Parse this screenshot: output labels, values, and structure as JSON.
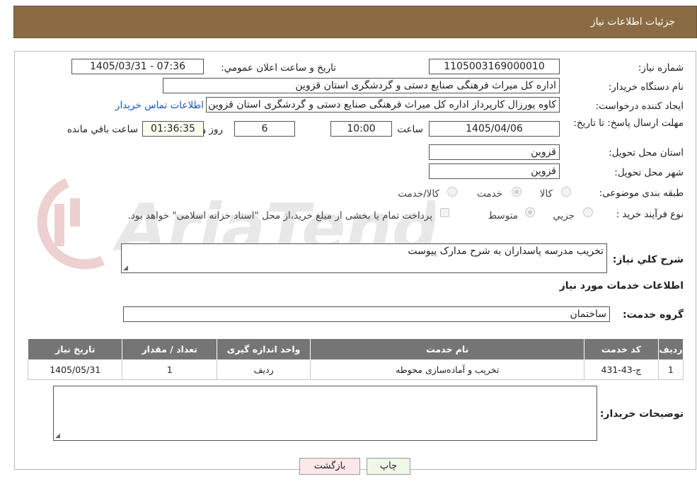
{
  "header": {
    "title": "جزئیات اطلاعات نیاز"
  },
  "form": {
    "need_number_label": "شماره نیاز:",
    "need_number": "1105003169000010",
    "announce_label": "تاریخ و ساعت اعلان عمومي:",
    "announce_value": "1405/03/31 - 07:36",
    "buyer_org_label": "نام دستگاه خريدار:",
    "buyer_org": "اداره کل میراث فرهنگی  صنایع دستی و گردشگری استان قزوین",
    "creator_label": "ايجاد کننده درخواست:",
    "creator": "کاوه پورزال کارپرداز اداره کل میراث فرهنگی  صنایع دستی و گردشگری استان قزوین",
    "contact_link": "اطلاعات تماس خريدار",
    "deadline_label": "مهلت ارسال پاسخ: تا تاريخ:",
    "deadline_date": "1405/04/06",
    "time_label": "ساعت",
    "deadline_time": "10:00",
    "days_value": "6",
    "days_label": "روز و",
    "remaining_time": "01:36:35",
    "remaining_label": "ساعت باقي مانده",
    "province_label": "استان محل تحويل:",
    "province": "قزوین",
    "city_label": "شهر محل تحويل:",
    "city": "قزوین",
    "category_label": "طبقه بندی موضوعی:",
    "category_options": [
      "کالا",
      "خدمت",
      "کالا/خدمت"
    ],
    "process_label": "نوع فرآيند خريد :",
    "process_options": [
      "جزيي",
      "متوسط"
    ],
    "payment_note": "پرداخت تمام یا بخشی از مبلغ خرید،از محل \"اسناد خزانه اسلامی\" خواهد بود.",
    "summary_label": "شرح کلي نياز:",
    "summary": "تخریب مدرسه پاسداران به شرح مدارک پیوست",
    "services_title": "اطلاعات خدمات مورد نياز",
    "service_group_label": "گروه خدمت:",
    "service_group": "ساختمان",
    "buyer_notes_label": "توضيحات خريدار:",
    "buyer_notes": ""
  },
  "table": {
    "headers": [
      "رديف",
      "کد خدمت",
      "نام خدمت",
      "واحد اندازه گيری",
      "تعداد / مقدار",
      "تاريخ نياز"
    ],
    "rows": [
      [
        "1",
        "ج-43-431",
        "تخریب و آماده‌سازی محوطه",
        "ردیف",
        "1",
        "1405/05/31"
      ]
    ]
  },
  "buttons": {
    "print": "چاپ",
    "back": "بازگشت"
  },
  "watermark": "AriaTender.neT",
  "colors": {
    "header": "#8b6b43",
    "table_header": "#757575",
    "link": "#1a56c4",
    "back_button": "#fde8e8",
    "print_button": "#eef7e8"
  }
}
